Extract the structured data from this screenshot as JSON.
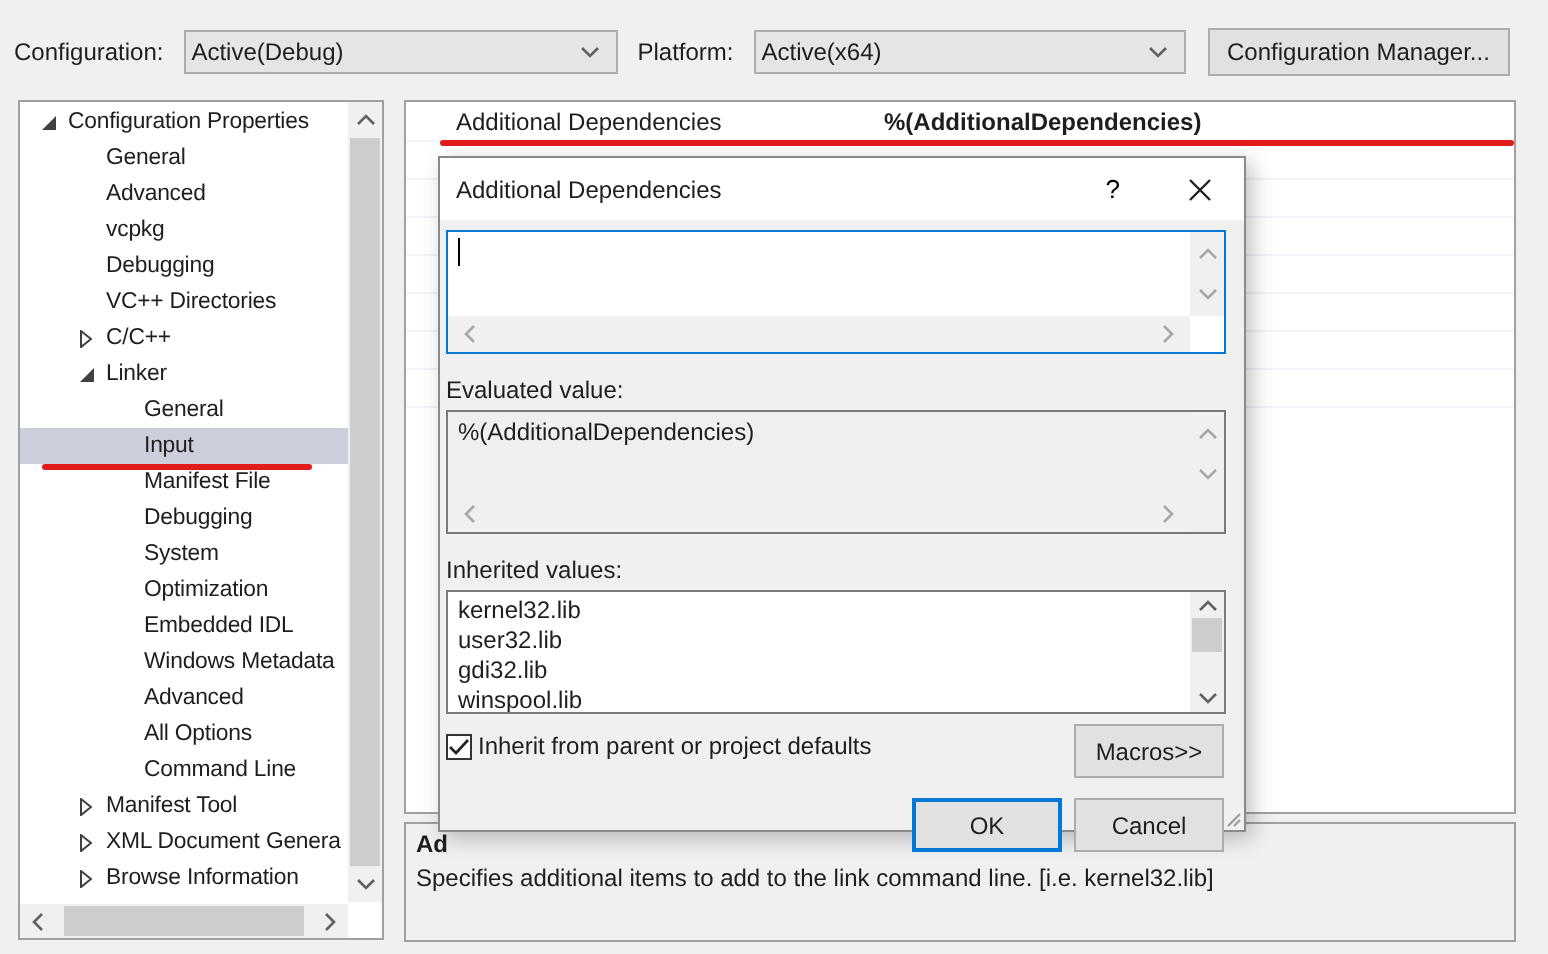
{
  "toolbar": {
    "configuration_label": "Configuration:",
    "configuration_value": "Active(Debug)",
    "platform_label": "Platform:",
    "platform_value": "Active(x64)",
    "manager_button": "Configuration Manager..."
  },
  "tree": {
    "items": [
      {
        "label": "Configuration Properties",
        "expanded": true,
        "selected": false,
        "underlined": false,
        "children": [
          {
            "label": "General",
            "selected": false,
            "underlined": false
          },
          {
            "label": "Advanced",
            "selected": false,
            "underlined": false
          },
          {
            "label": "vcpkg",
            "selected": false,
            "underlined": false
          },
          {
            "label": "Debugging",
            "selected": false,
            "underlined": false
          },
          {
            "label": "VC++ Directories",
            "selected": false,
            "underlined": false
          },
          {
            "label": "C/C++",
            "expanded": false,
            "selected": false,
            "underlined": false
          },
          {
            "label": "Linker",
            "expanded": true,
            "selected": false,
            "underlined": false,
            "children": [
              {
                "label": "General",
                "selected": false,
                "underlined": false
              },
              {
                "label": "Input",
                "selected": true,
                "underlined": true
              },
              {
                "label": "Manifest File",
                "selected": false,
                "underlined": false
              },
              {
                "label": "Debugging",
                "selected": false,
                "underlined": false
              },
              {
                "label": "System",
                "selected": false,
                "underlined": false
              },
              {
                "label": "Optimization",
                "selected": false,
                "underlined": false
              },
              {
                "label": "Embedded IDL",
                "selected": false,
                "underlined": false
              },
              {
                "label": "Windows Metadata",
                "selected": false,
                "underlined": false
              },
              {
                "label": "Advanced",
                "selected": false,
                "underlined": false
              },
              {
                "label": "All Options",
                "selected": false,
                "underlined": false
              },
              {
                "label": "Command Line",
                "selected": false,
                "underlined": false
              }
            ]
          },
          {
            "label": "Manifest Tool",
            "expanded": false,
            "selected": false,
            "underlined": false
          },
          {
            "label": "XML Document Genera",
            "expanded": false,
            "selected": false,
            "underlined": false
          },
          {
            "label": "Browse Information",
            "expanded": false,
            "selected": false,
            "underlined": false
          }
        ]
      }
    ]
  },
  "property_grid": {
    "rows": [
      {
        "name": "Additional Dependencies",
        "value": "%(AdditionalDependencies)",
        "underlined": true
      }
    ]
  },
  "description": {
    "title": "Ad",
    "text": "Specifies additional items to add to the link command line. [i.e. kernel32.lib]"
  },
  "dialog": {
    "title": "Additional Dependencies",
    "help": "?",
    "edit_box": {
      "focused": true
    },
    "evaluated_label": "Evaluated value:",
    "evaluated_value": "%(AdditionalDependencies)",
    "inherited_label": "Inherited values:",
    "inherited_values": [
      "kernel32.lib",
      "user32.lib",
      "gdi32.lib",
      "winspool.lib"
    ],
    "checkbox": {
      "label": "Inherit from parent or project defaults",
      "checked": true
    },
    "macros_button": "Macros>>",
    "buttons": [
      {
        "label": "OK",
        "default": true
      },
      {
        "label": "Cancel",
        "default": false
      }
    ]
  }
}
